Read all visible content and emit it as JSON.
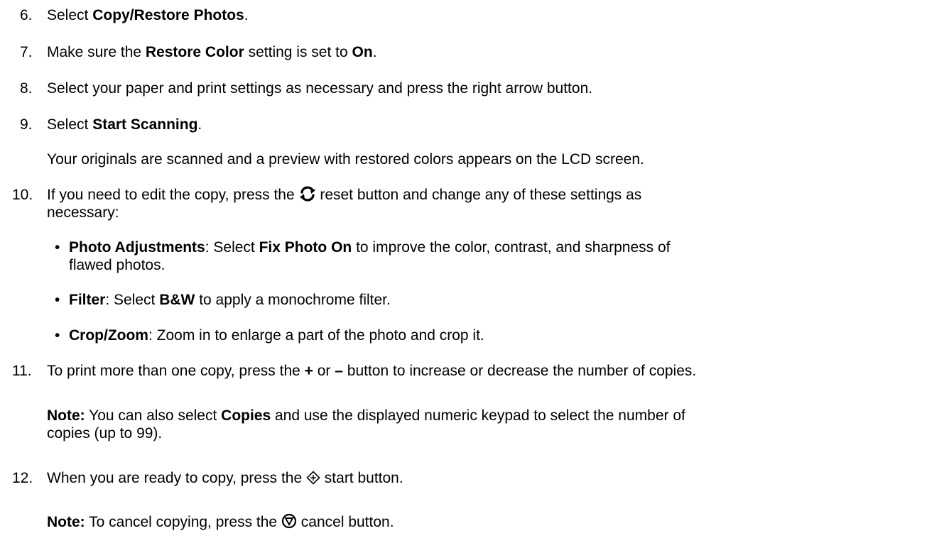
{
  "steps": {
    "s6": {
      "num": "6.",
      "a": "Select ",
      "b": "Copy/Restore Photos",
      "c": "."
    },
    "s7": {
      "num": "7.",
      "a": "Make sure the ",
      "b": "Restore Color",
      "c": " setting is set to ",
      "d": "On",
      "e": "."
    },
    "s8": {
      "num": "8.",
      "a": "Select your paper and print settings as necessary and press the right arrow button."
    },
    "s9": {
      "num": "9.",
      "a": "Select ",
      "b": "Start Scanning",
      "c": ".",
      "result": "Your originals are scanned and a preview with restored colors appears on the LCD screen."
    },
    "s10": {
      "num": "10.",
      "a": "If you need to edit the copy, press the ",
      "b": " reset button and change any of these settings as",
      "c": "necessary:",
      "bullets": [
        {
          "bold": "Photo Adjustments",
          "a": ": Select ",
          "b": "Fix Photo On",
          "c": " to improve the color, contrast, and sharpness of",
          "d": "flawed photos."
        },
        {
          "bold": "Filter",
          "a": ": Select ",
          "b": "B&W",
          "c": " to apply a monochrome filter."
        },
        {
          "bold": "Crop/Zoom",
          "a": ": Zoom in to enlarge a part of the photo and crop it."
        }
      ]
    },
    "s11": {
      "num": "11.",
      "a": "To print more than one copy, press the ",
      "plus": "+",
      "b": " or ",
      "minus": "–",
      "c": " button to increase or decrease the number of copies.",
      "note_label": "Note:",
      "note_a": " You can also select ",
      "note_b": "Copies",
      "note_c": " and use the displayed numeric keypad to select the number of",
      "note_d": "copies (up to 99)."
    },
    "s12": {
      "num": "12.",
      "a": "When you are ready to copy, press the ",
      "b": " start button.",
      "note_label": "Note:",
      "note_a": " To cancel copying, press the ",
      "note_b": " cancel button."
    }
  },
  "icons": {
    "reset": "reset-icon",
    "start": "start-icon",
    "cancel": "cancel-icon"
  },
  "colors": {
    "text": "#000000",
    "background": "#ffffff"
  }
}
